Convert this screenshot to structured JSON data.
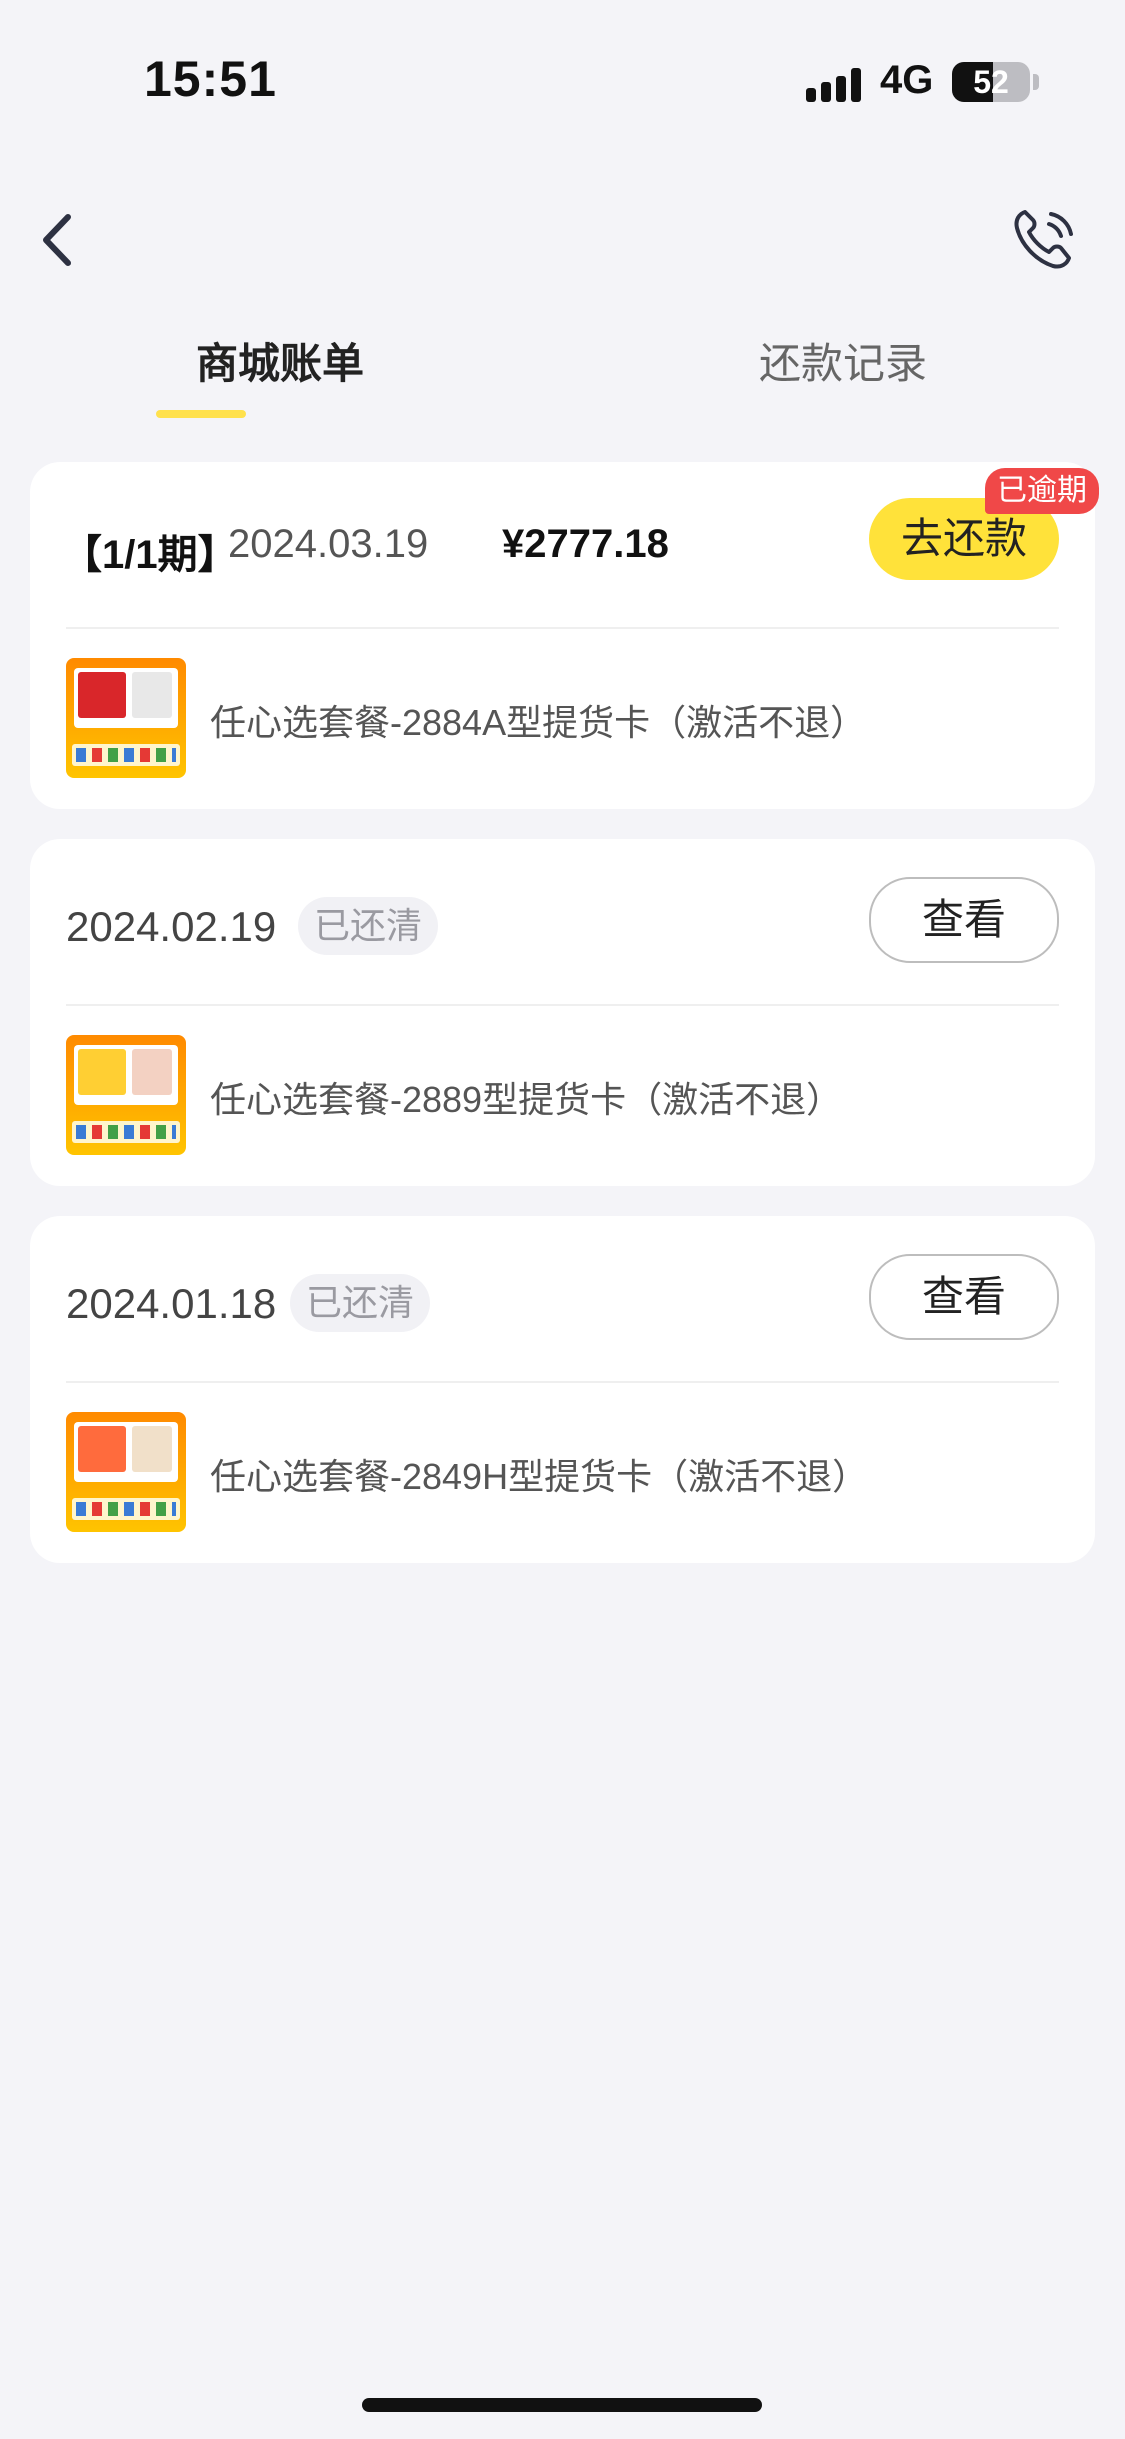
{
  "status_bar": {
    "time": "15:51",
    "network": "4G",
    "battery": "52"
  },
  "tabs": [
    {
      "label": "商城账单",
      "active": true
    },
    {
      "label": "还款记录",
      "active": false
    }
  ],
  "bills": [
    {
      "period": "【1/1期】",
      "date": "2024.03.19",
      "amount": "¥2777.18",
      "action_label": "去还款",
      "overdue_tag": "已逾期",
      "product": "任心选套餐-2884A型提货卡（激活不退）"
    },
    {
      "date": "2024.02.19",
      "status": "已还清",
      "action_label": "查看",
      "product": "任心选套餐-2889型提货卡（激活不退）"
    },
    {
      "date": "2024.01.18",
      "status": "已还清",
      "action_label": "查看",
      "product": "任心选套餐-2849H型提货卡（激活不退）"
    }
  ],
  "icons": {
    "back": "chevron-left-icon",
    "phone": "phone-icon"
  },
  "colors": {
    "accent": "#ffe23a",
    "overdue": "#f04848",
    "background": "#f4f4f8"
  }
}
